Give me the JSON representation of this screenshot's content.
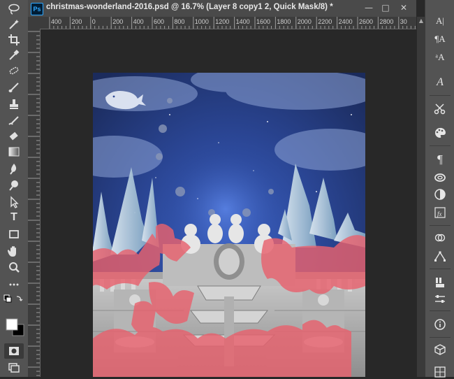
{
  "document": {
    "title": "christmas-wonderland-2016.psd @ 16.7% (Layer 8 copy1 2, Quick Mask/8) *",
    "app_logo": "Ps"
  },
  "window_controls": {
    "minimize": "—",
    "maximize": "□",
    "close": "✕"
  },
  "ruler": {
    "horizontal_labels": [
      "400",
      "200",
      "0",
      "200",
      "400",
      "600",
      "800",
      "1000",
      "1200",
      "1400",
      "1600",
      "1800",
      "2000",
      "2200",
      "2400",
      "2600",
      "2800",
      "30"
    ]
  },
  "tools": [
    {
      "name": "lasso-tool",
      "icon": "lasso-icon"
    },
    {
      "name": "magic-wand-tool",
      "icon": "magic-wand-icon"
    },
    {
      "name": "crop-tool",
      "icon": "crop-icon"
    },
    {
      "name": "eyedropper-tool",
      "icon": "eyedropper-icon"
    },
    {
      "name": "spot-healing-tool",
      "icon": "bandage-icon"
    },
    {
      "name": "brush-tool",
      "icon": "brush-icon"
    },
    {
      "name": "clone-stamp-tool",
      "icon": "stamp-icon"
    },
    {
      "name": "history-brush-tool",
      "icon": "history-brush-icon"
    },
    {
      "name": "eraser-tool",
      "icon": "eraser-icon"
    },
    {
      "name": "gradient-tool",
      "icon": "gradient-icon"
    },
    {
      "name": "blur-tool",
      "icon": "blur-icon"
    },
    {
      "name": "dodge-tool",
      "icon": "dodge-icon"
    },
    {
      "name": "path-selection-tool",
      "icon": "arrow-icon"
    },
    {
      "name": "type-tool",
      "icon": "type-icon",
      "label": "T"
    },
    {
      "name": "rectangle-tool",
      "icon": "rectangle-icon"
    },
    {
      "name": "hand-tool",
      "icon": "hand-icon"
    },
    {
      "name": "zoom-tool",
      "icon": "zoom-icon"
    },
    {
      "name": "more-tools",
      "icon": "ellipsis-icon"
    },
    {
      "name": "color-swatches",
      "icon": "color-swatch-icon"
    },
    {
      "name": "quick-mask-mode",
      "icon": "quick-mask-icon"
    },
    {
      "name": "screen-mode",
      "icon": "screen-mode-icon"
    }
  ],
  "right_panel": [
    {
      "name": "character-panel",
      "label": "A|"
    },
    {
      "name": "paragraph-panel",
      "label": "¶A"
    },
    {
      "name": "character-styles",
      "label": "ᵃA"
    },
    {
      "name": "glyphs-panel",
      "label": "A"
    },
    {
      "name": "tools-panel",
      "icon": "scissors-icon"
    },
    {
      "name": "swatches-panel",
      "icon": "palette-icon"
    },
    {
      "name": "paragraph-styles",
      "label": "¶"
    },
    {
      "name": "libraries-panel",
      "icon": "libraries-icon"
    },
    {
      "name": "adjustments-panel",
      "icon": "adjustments-icon"
    },
    {
      "name": "styles-panel",
      "icon": "fx-icon"
    },
    {
      "name": "layers-panel",
      "icon": "layers-icon"
    },
    {
      "name": "paths-panel",
      "icon": "paths-icon"
    },
    {
      "name": "brushes-panel",
      "icon": "brushes-icon"
    },
    {
      "name": "properties-panel",
      "icon": "properties-icon"
    },
    {
      "name": "info-panel",
      "icon": "info-icon"
    },
    {
      "name": "3d-panel",
      "icon": "cube-icon"
    },
    {
      "name": "timeline-panel",
      "icon": "grid-icon"
    }
  ],
  "colors": {
    "quick_mask_overlay": "#e8626e",
    "sky_top": "#1f3266",
    "sky_glow": "#3c63c8",
    "panel_bg": "#535353",
    "workspace_bg": "#282828"
  }
}
